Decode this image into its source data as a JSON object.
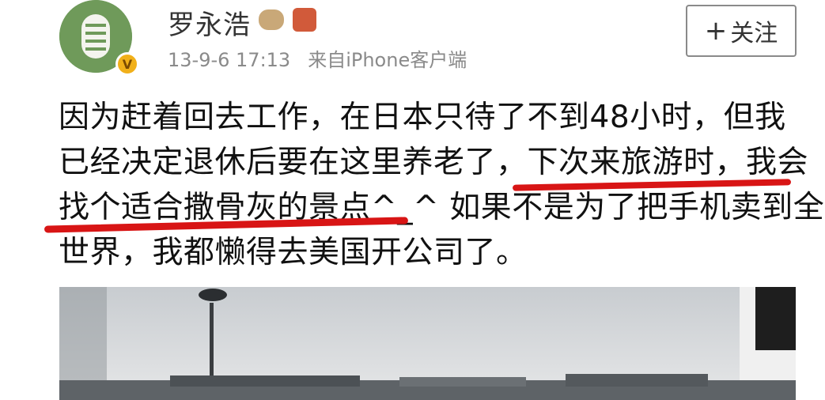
{
  "user": {
    "name": "罗永浩",
    "verified_mark": "V"
  },
  "post_meta": {
    "datetime": "13-9-6 17:13",
    "source": "来自iPhone客户端"
  },
  "follow_button": {
    "icon": "plus-icon",
    "label": "关注"
  },
  "post": {
    "lines": [
      "因为赶着回去工作，在日本只待了不到48小时，但我",
      "已经决定退休后要在这里养老了，下次来旅游时，我会",
      "找个适合撒骨灰的景点^_^ 如果不是为了把手机卖到全",
      "世界，我都懒得去美国开公司了。"
    ]
  },
  "colors": {
    "highlight": "#d81515",
    "meta_gray": "#8a8a8a",
    "verified_badge": "#f1b01a"
  }
}
